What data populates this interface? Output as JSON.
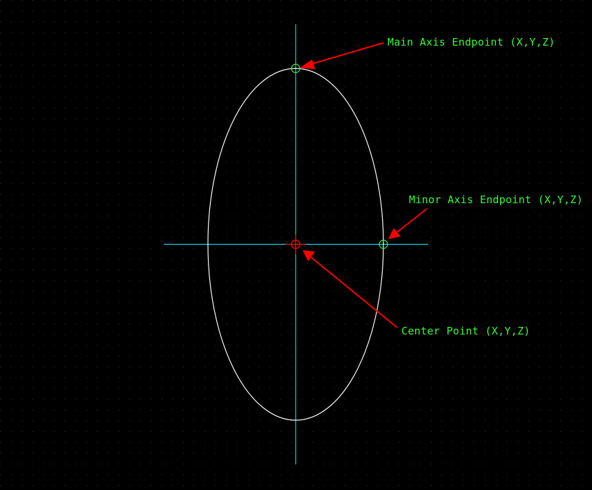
{
  "colors": {
    "background": "#000000",
    "grid_dot": "#3a3a3a",
    "axis_line": "#00d8e8",
    "ellipse": "#ffffff",
    "label_text": "#33ff33",
    "arrow": "#ff0000",
    "center_marker": "#ff0000",
    "endpoint_marker": "#33ff33"
  },
  "labels": {
    "main_axis": "Main Axis Endpoint (X,Y,Z)",
    "minor_axis": "Minor Axis Endpoint (X,Y,Z)",
    "center": "Center Point (X,Y,Z)"
  },
  "icons": {
    "center_marker": "circle-crosshair-icon",
    "endpoint_marker": "circle-icon",
    "arrow": "arrowhead-icon"
  }
}
